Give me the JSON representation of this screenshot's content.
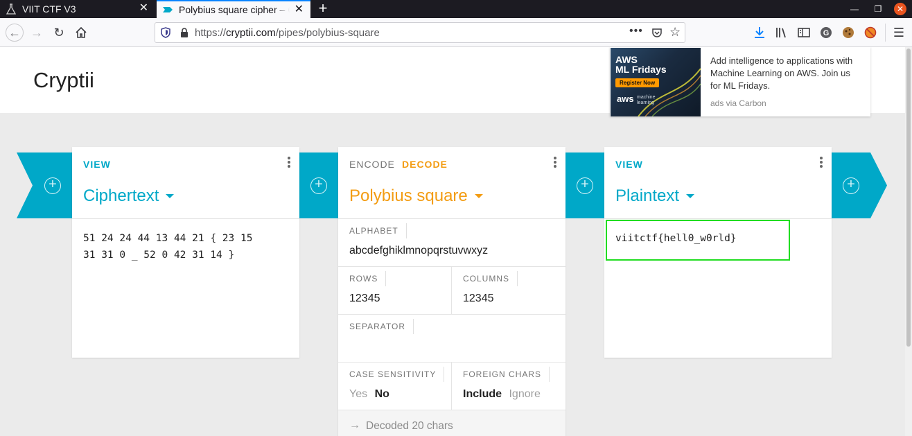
{
  "browser": {
    "tabs": [
      {
        "title": "VIIT CTF V3",
        "icon": "ctf-flask-icon",
        "active": false
      },
      {
        "title": "Polybius square cipher – Cryptii",
        "icon": "cryptii-icon",
        "active": true
      }
    ],
    "new_tab": "+",
    "url_prefix": "https://",
    "url_domain": "cryptii.com",
    "url_path": "/pipes/polybius-square",
    "url_more": "•••"
  },
  "page": {
    "site_title": "Cryptii",
    "ad": {
      "headline_line1": "AWS",
      "headline_line2": "ML Fridays",
      "register": "Register Now",
      "aws_logo": "aws",
      "aws_sub": "machine learning",
      "text": "Add intelligence to applications with Machine Learning on AWS. Join us for ML Fridays.",
      "via": "ads via Carbon"
    }
  },
  "cards": {
    "ciphertext": {
      "mode": "VIEW",
      "title": "Ciphertext",
      "content_line1": "51 24 24 44 13 44 21 { 23 15",
      "content_line2": "31 31 0 _ 52 0 42 31 14 }"
    },
    "polybius": {
      "mode_encode": "ENCODE",
      "mode_decode": "DECODE",
      "title": "Polybius square",
      "alphabet_label": "ALPHABET",
      "alphabet_value": "abcdefghiklmnopqrstuvwxyz",
      "rows_label": "ROWS",
      "rows_value": "12345",
      "columns_label": "COLUMNS",
      "columns_value": "12345",
      "separator_label": "SEPARATOR",
      "separator_value": "",
      "case_label": "CASE SENSITIVITY",
      "case_yes": "Yes",
      "case_no": "No",
      "foreign_label": "FOREIGN CHARS",
      "foreign_include": "Include",
      "foreign_ignore": "Ignore",
      "status": "Decoded 20 chars"
    },
    "plaintext": {
      "mode": "VIEW",
      "title": "Plaintext",
      "content": "viitctf{hell0_w0rld}"
    }
  },
  "colors": {
    "accent": "#00a8c8",
    "decode": "#f39c12",
    "highlight": "#22dd22"
  }
}
